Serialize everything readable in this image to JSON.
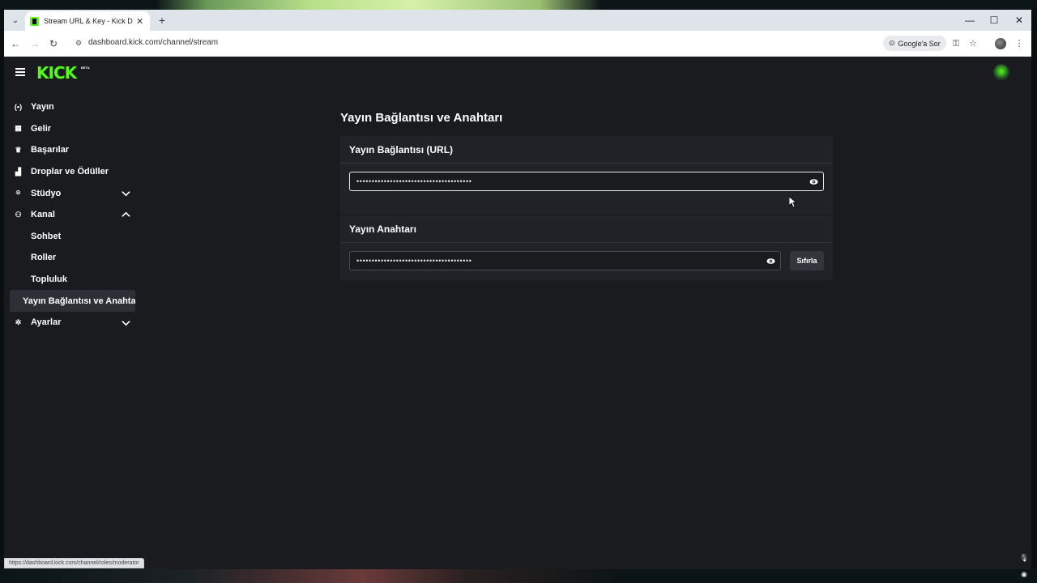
{
  "browser": {
    "tab_title": "Stream URL & Key - Kick Dashb",
    "tab_close": "✕",
    "new_tab": "+",
    "url": "dashboard.kick.com/channel/stream",
    "google_button": "Google'a Sor",
    "status_url": "https://dashboard.kick.com/channel/roles/moderator",
    "window_controls": [
      "—",
      "☐",
      "✕"
    ]
  },
  "brand": {
    "logo": "KICK",
    "beta": "BETA",
    "accent_color": "#53fc18"
  },
  "sidebar": {
    "items": [
      {
        "label": "Yayın",
        "icon": "broadcast-icon"
      },
      {
        "label": "Gelir",
        "icon": "revenue-icon"
      },
      {
        "label": "Başarılar",
        "icon": "trophy-icon"
      },
      {
        "label": "Droplar ve Ödüller",
        "icon": "drops-icon"
      },
      {
        "label": "Stüdyo",
        "icon": "studio-icon",
        "expandable": true,
        "expanded": false
      },
      {
        "label": "Kanal",
        "icon": "channel-icon",
        "expandable": true,
        "expanded": true
      }
    ],
    "kanal_subitems": [
      {
        "label": "Sohbet"
      },
      {
        "label": "Roller"
      },
      {
        "label": "Topluluk"
      },
      {
        "label": "Yayın Bağlantısı ve Anahtarı",
        "active": true
      }
    ],
    "settings": {
      "label": "Ayarlar",
      "icon": "gear-icon",
      "expandable": true
    }
  },
  "main": {
    "title": "Yayın Bağlantısı ve Anahtarı",
    "url_card": {
      "header": "Yayın Bağlantısı (URL)",
      "value": "••••••••••••••••••••••••••••••••••••••"
    },
    "key_card": {
      "header": "Yayın Anahtarı",
      "value": "••••••••••••••••••••••••••••••••••••••",
      "reset_label": "Sıfırla"
    }
  }
}
